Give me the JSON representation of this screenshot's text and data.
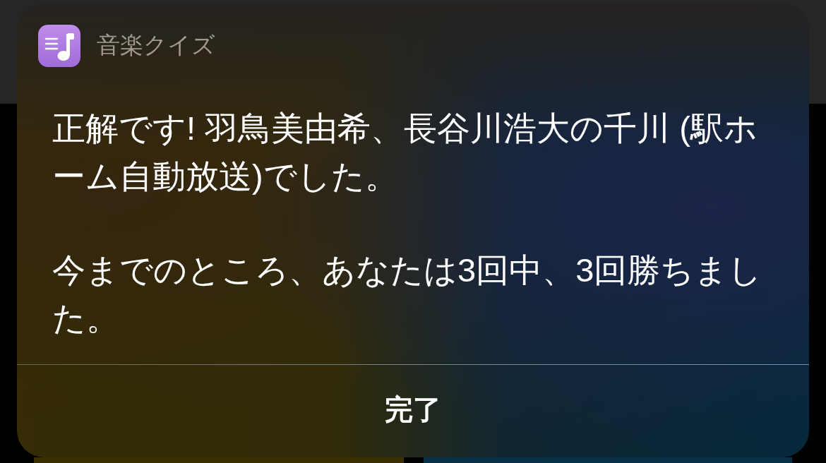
{
  "app": {
    "name": "音楽クイズ"
  },
  "message": {
    "paragraphs": [
      "正解です! 羽鳥美由希、長谷川浩大の千川 (駅ホーム自動放送)でした。",
      "今までのところ、あなたは3回中、3回勝ちました。"
    ]
  },
  "actions": [
    {
      "label": "完了"
    }
  ]
}
